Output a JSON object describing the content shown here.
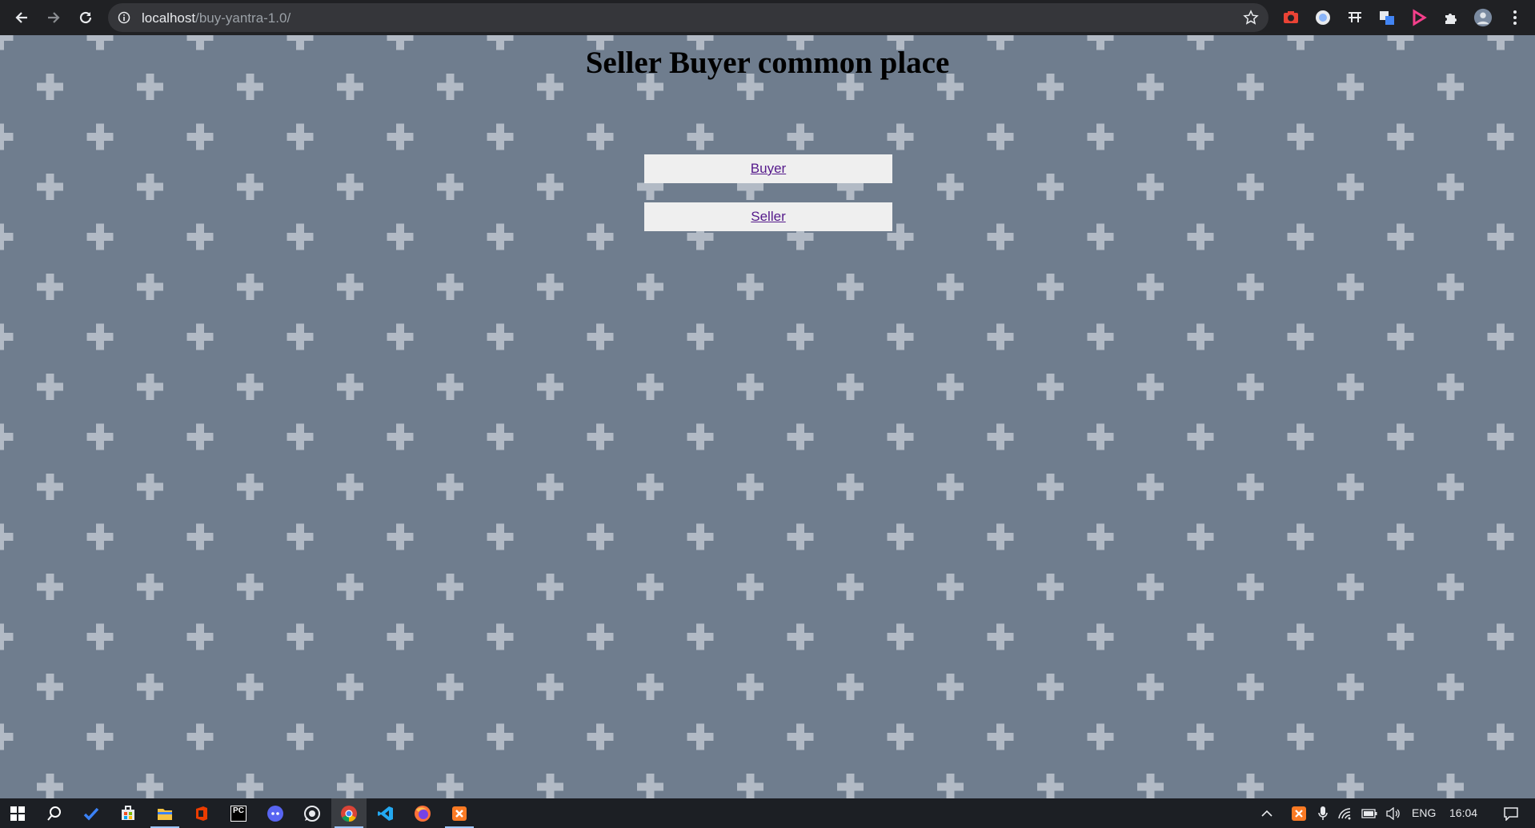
{
  "browser": {
    "url_host": "localhost",
    "url_path": "/buy-yantra-1.0/",
    "nav_icons": [
      "back-icon",
      "forward-icon",
      "reload-icon"
    ],
    "omnibox_icons": [
      "info-icon",
      "bookmark-star-icon"
    ],
    "extensions": [
      "screenshot-extension-icon",
      "extension-icon",
      "translate-extension-icon",
      "google-translate-icon",
      "media-extension-icon",
      "extensions-puzzle-icon",
      "profile-avatar",
      "menu-kebab-icon"
    ]
  },
  "page": {
    "title": "Seller Buyer common place",
    "buttons": [
      {
        "label": "Buyer"
      },
      {
        "label": "Seller"
      }
    ],
    "background_color": "#6f7d8e",
    "pattern_color": "#b2bac5"
  },
  "taskbar": {
    "apps": [
      "windows-start-icon",
      "search-icon",
      "todo-icon",
      "store-icon",
      "file-explorer-icon",
      "office-icon",
      "pycharm-icon",
      "discord-icon",
      "whatsapp-icon",
      "chrome-icon",
      "vscode-icon",
      "firefox-icon",
      "xampp-icon"
    ],
    "pycharm_label": "PC",
    "tray": {
      "language": "ENG",
      "time": "16:04"
    }
  }
}
